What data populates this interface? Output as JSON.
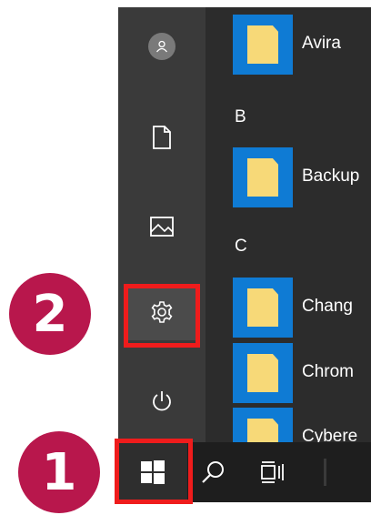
{
  "start_menu": {
    "rail": [
      {
        "icon": "user-avatar-icon"
      },
      {
        "icon": "document-icon"
      },
      {
        "icon": "pictures-icon"
      },
      {
        "icon": "settings-gear-icon"
      },
      {
        "icon": "power-icon"
      }
    ],
    "sections": [
      {
        "letter": "B"
      },
      {
        "letter": "C"
      }
    ],
    "apps": [
      {
        "name": "Avira"
      },
      {
        "name": "Backup"
      },
      {
        "name": "Chang"
      },
      {
        "name": "Chrom"
      },
      {
        "name": "Cybere"
      }
    ]
  },
  "taskbar": {
    "items": [
      {
        "icon": "windows-start-icon"
      },
      {
        "icon": "search-icon"
      },
      {
        "icon": "task-view-icon"
      }
    ]
  },
  "annotations": {
    "step1": "1",
    "step2": "2",
    "highlight_color": "#ef1c1c",
    "badge_color": "#b8174c"
  },
  "colors": {
    "tile_blue": "#0f7bd4",
    "folder_yellow": "#f7d978"
  }
}
